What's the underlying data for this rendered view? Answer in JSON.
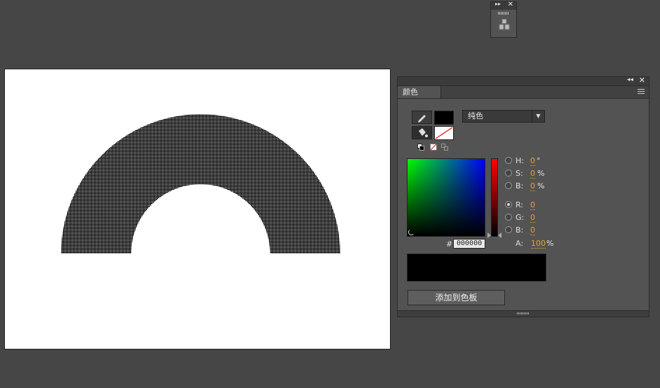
{
  "mini_panel": {
    "collapse_glyph": "▸▸",
    "close_glyph": "✕",
    "icon": "boxes-icon"
  },
  "stage": {
    "background": "#ffffff",
    "shape": "black dotted half-ring"
  },
  "color_panel": {
    "collapse_glyph": "◂◂",
    "close_glyph": "✕",
    "tab_label": "颜色",
    "fill_type": "纯色",
    "stroke_color": "#000000",
    "fill_color": "none",
    "fields": {
      "H": {
        "label": "H:",
        "value": "0",
        "unit": "°"
      },
      "S": {
        "label": "S:",
        "value": "0",
        "unit": "%"
      },
      "B1": {
        "label": "B:",
        "value": "0",
        "unit": "%"
      },
      "R": {
        "label": "R:",
        "value": "0",
        "unit": ""
      },
      "G": {
        "label": "G:",
        "value": "0",
        "unit": ""
      },
      "B2": {
        "label": "B:",
        "value": "0",
        "unit": ""
      }
    },
    "hex_label": "#",
    "hex_value": "000000",
    "alpha_label": "A:",
    "alpha_value": "100",
    "alpha_unit": "%",
    "add_button": "添加到色板",
    "colors": {
      "accent_value": "#e4a52a",
      "preview": "#000000"
    }
  }
}
